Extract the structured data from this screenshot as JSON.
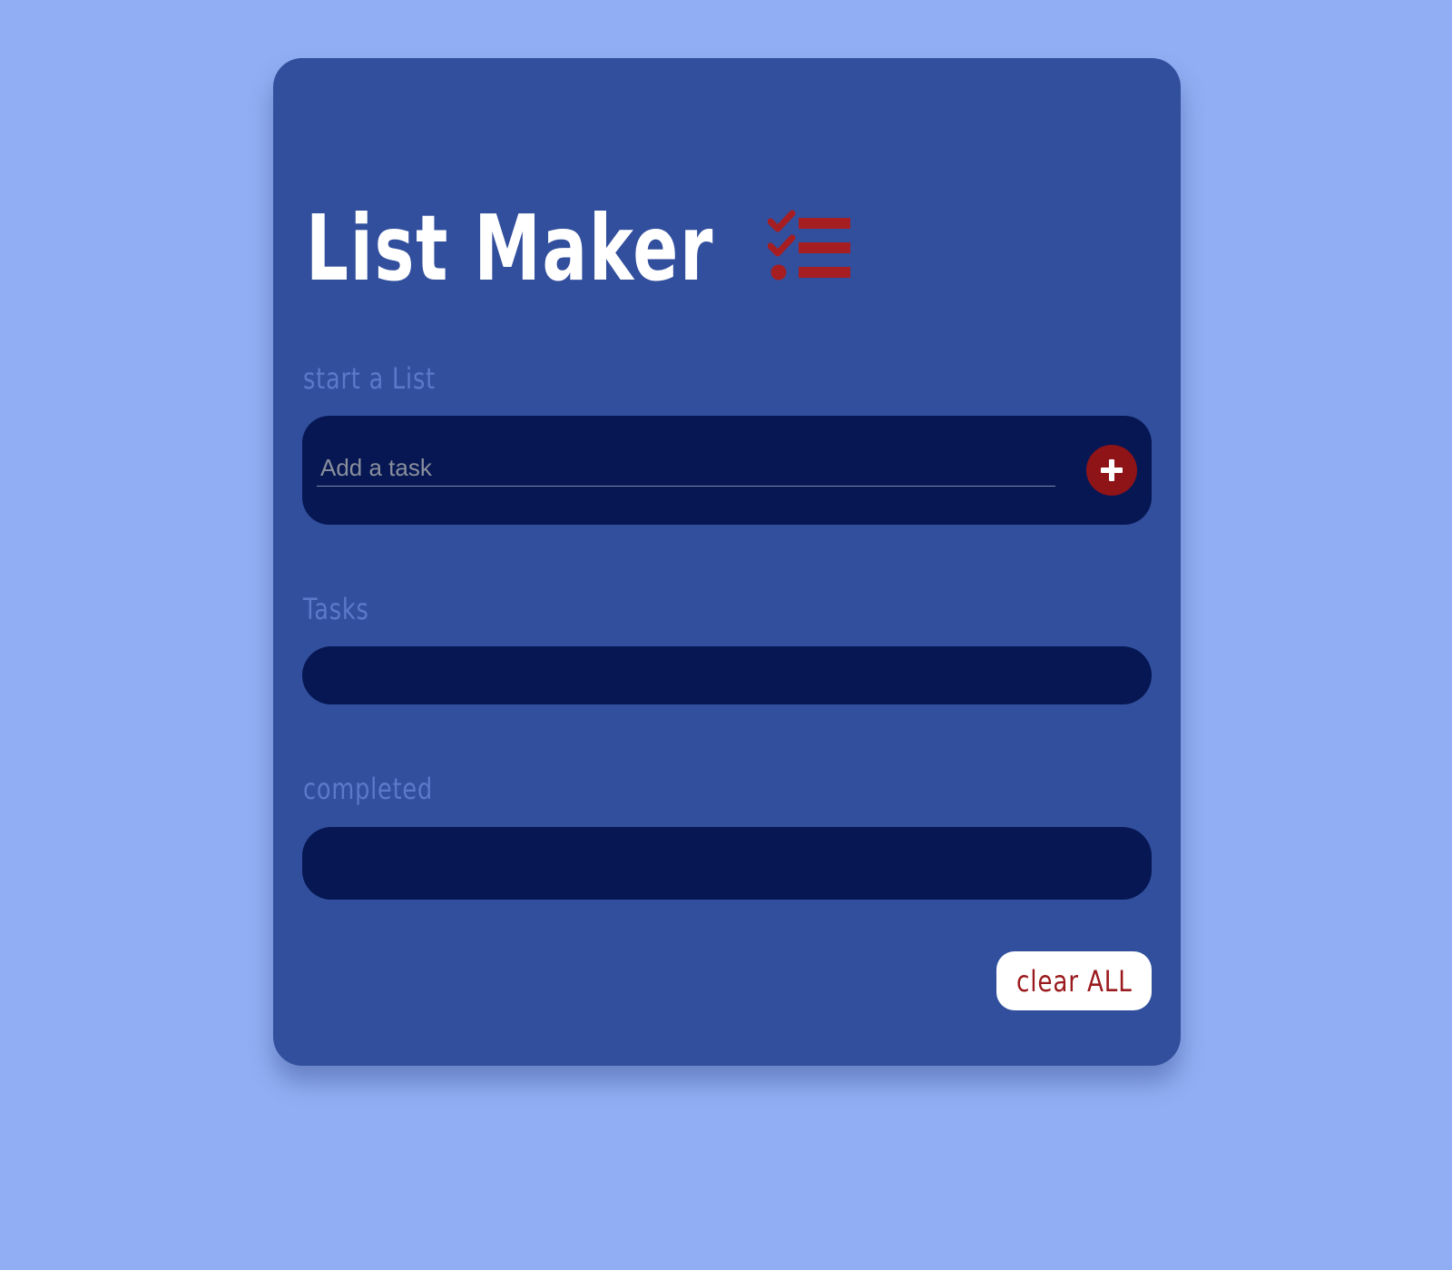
{
  "app": {
    "title": "List Maker"
  },
  "icons": {
    "logo": "checklist-icon",
    "add": "plus-icon"
  },
  "colors": {
    "page_background": "#91aef4",
    "card_background": "#324f9d",
    "panel_background": "#061753",
    "accent_red": "#8f1418",
    "label_color": "#5b79c9"
  },
  "add_section": {
    "label": "start a List",
    "input_placeholder": "Add a task",
    "input_value": ""
  },
  "tasks_section": {
    "label": "Tasks",
    "items": []
  },
  "completed_section": {
    "label": "completed",
    "items": []
  },
  "actions": {
    "clear_all_label": "clear ALL"
  }
}
